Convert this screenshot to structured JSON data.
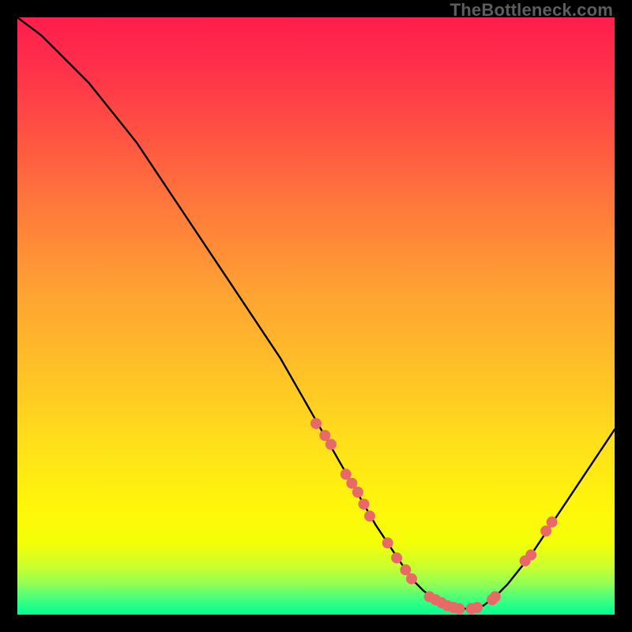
{
  "watermark": "TheBottleneck.com",
  "colors": {
    "curve": "#000000",
    "marker_fill": "#e86a67",
    "marker_stroke": "#c24845"
  },
  "chart_data": {
    "type": "line",
    "title": "",
    "xlabel": "",
    "ylabel": "",
    "xlim": [
      0,
      100
    ],
    "ylim": [
      0,
      100
    ],
    "grid": false,
    "curve": {
      "name": "bottleneck-curve",
      "x": [
        0,
        4,
        8,
        12,
        16,
        20,
        24,
        28,
        32,
        36,
        40,
        44,
        48,
        52,
        56,
        60,
        62,
        64,
        66,
        68,
        70,
        72,
        74,
        76,
        78,
        80,
        82,
        86,
        90,
        94,
        98,
        100
      ],
      "y": [
        100,
        97,
        93,
        89,
        84,
        79,
        73,
        67,
        61,
        55,
        49,
        43,
        36,
        29,
        22,
        15,
        12,
        9,
        6,
        4,
        2.5,
        1.5,
        1.0,
        1.0,
        1.5,
        3,
        5,
        10,
        16,
        22,
        28,
        31
      ]
    },
    "markers": [
      {
        "x": 50.0,
        "y": 32.0
      },
      {
        "x": 51.5,
        "y": 30.0
      },
      {
        "x": 52.5,
        "y": 28.5
      },
      {
        "x": 55.0,
        "y": 23.5
      },
      {
        "x": 56.0,
        "y": 22.0
      },
      {
        "x": 57.0,
        "y": 20.5
      },
      {
        "x": 58.0,
        "y": 18.5
      },
      {
        "x": 59.0,
        "y": 16.5
      },
      {
        "x": 62.0,
        "y": 12.0
      },
      {
        "x": 63.5,
        "y": 9.5
      },
      {
        "x": 65.0,
        "y": 7.5
      },
      {
        "x": 66.0,
        "y": 6.0
      },
      {
        "x": 69.0,
        "y": 3.0
      },
      {
        "x": 70.0,
        "y": 2.5
      },
      {
        "x": 71.0,
        "y": 2.0
      },
      {
        "x": 72.0,
        "y": 1.5
      },
      {
        "x": 73.0,
        "y": 1.2
      },
      {
        "x": 74.0,
        "y": 1.0
      },
      {
        "x": 76.0,
        "y": 1.0
      },
      {
        "x": 77.0,
        "y": 1.2
      },
      {
        "x": 79.5,
        "y": 2.5
      },
      {
        "x": 80.0,
        "y": 3.0
      },
      {
        "x": 85.0,
        "y": 9.0
      },
      {
        "x": 86.0,
        "y": 10.0
      },
      {
        "x": 88.5,
        "y": 14.0
      },
      {
        "x": 89.5,
        "y": 15.5
      }
    ]
  }
}
